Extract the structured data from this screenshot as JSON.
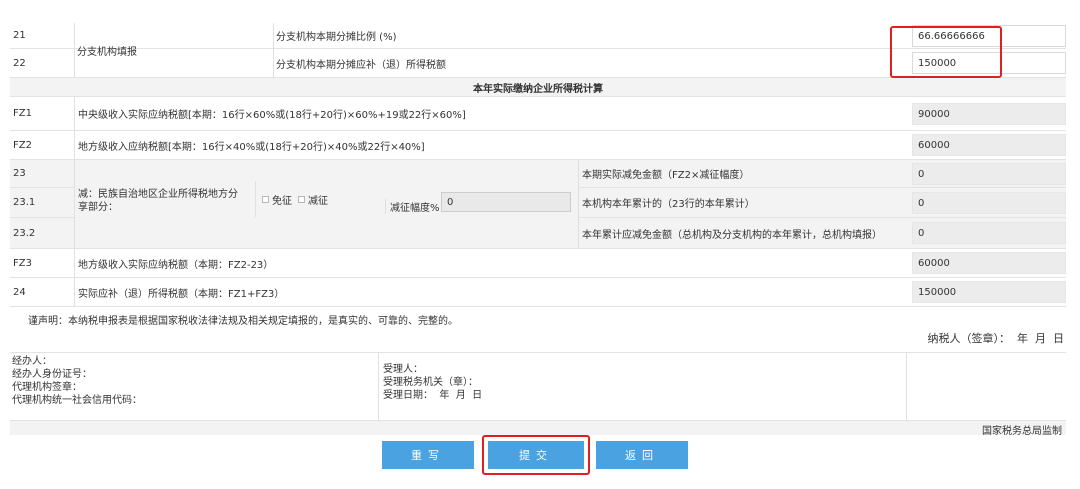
{
  "rows": {
    "r21": {
      "no": "21",
      "item": "分支机构本期分摊比例 (%)",
      "value": "66.66666666"
    },
    "r22": {
      "no": "22",
      "item": "分支机构本期分摊应补（退）所得税额",
      "value": "150000"
    },
    "branch_group_label": "分支机构填报",
    "section_title": "本年实际缴纳企业所得税计算",
    "fz1": {
      "no": "FZ1",
      "item": "中央级收入实际应纳税额[本期：16行×60%或(18行+20行)×60%+19或22行×60%]",
      "value": "90000"
    },
    "fz2": {
      "no": "FZ2",
      "item": "地方级收入应纳税额[本期：16行×40%或(18行+20行)×40%或22行×40%]",
      "value": "60000"
    },
    "r23": {
      "no": "23",
      "item": "本期实际减免金额（FZ2×减征幅度）",
      "value": "0"
    },
    "r23_1": {
      "no": "23.1",
      "item": "本机构本年累计的（23行的本年累计）",
      "value": "0"
    },
    "r23_2": {
      "no": "23.2",
      "item": "本年累计应减免金额（总机构及分支机构的本年累计，总机构填报）",
      "value": "0"
    },
    "minority_label": "减：民族自治地区企业所得税地方分享部分：",
    "exempt_label": "免征",
    "reduce_label": "减征",
    "reduce_rate_label": "减征幅度%",
    "reduce_rate_value": "0",
    "fz3": {
      "no": "FZ3",
      "item": "地方级收入实际应纳税额（本期：FZ2-23）",
      "value": "60000"
    },
    "r24": {
      "no": "24",
      "item": "实际应补（退）所得税额（本期：FZ1+FZ3）",
      "value": "150000"
    }
  },
  "declaration": {
    "text": "谨声明：本纳税申报表是根据国家税收法律法规及相关规定填报的，是真实的、可靠的、完整的。",
    "signer": "纳税人（签章）：  年  月  日"
  },
  "footer_info": {
    "left": [
      "经办人：",
      "经办人身份证号：",
      "代理机构签章：",
      "代理机构统一社会信用代码："
    ],
    "right": [
      "受理人：",
      "受理税务机关（章）：",
      "受理日期：  年  月  日"
    ]
  },
  "supervisor": "国家税务总局监制",
  "buttons": {
    "rewrite": "重写",
    "submit": "提交",
    "back": "返回"
  },
  "colors": {
    "button": "#4aa3e0",
    "highlight": "#e02020"
  }
}
